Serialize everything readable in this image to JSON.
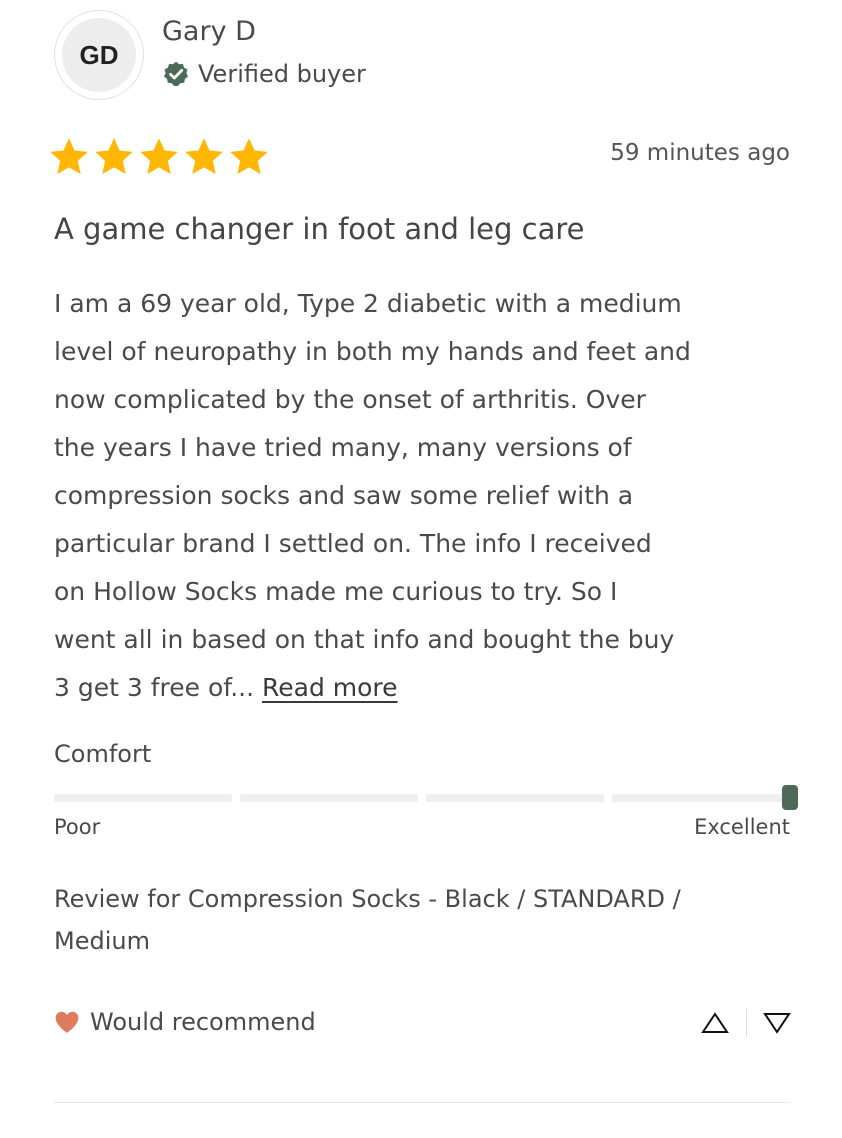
{
  "author": {
    "initials": "GD",
    "name": "Gary D",
    "verified_label": "Verified buyer"
  },
  "rating": {
    "stars": 5,
    "max_stars": 5
  },
  "timestamp": "59 minutes ago",
  "review": {
    "title": "A game changer in foot and leg care",
    "body_lines": [
      "I am a 69 year old, Type 2 diabetic with a medium",
      "level of neuropathy in both my hands and feet and",
      "now complicated by the onset of arthritis. Over",
      "the years I have tried many, many versions of",
      "compression socks and saw some relief with a",
      "particular brand I settled on. The info I received",
      "on Hollow Socks made me curious to try. So I",
      "went all in based on that info and bought the buy",
      "3 get 3 free of..."
    ],
    "read_more_label": "Read more"
  },
  "comfort": {
    "label": "Comfort",
    "min_label": "Poor",
    "max_label": "Excellent",
    "segments": 4,
    "value_fraction": 1.0
  },
  "product": {
    "lines": [
      "Review for Compression Socks - Black / STANDARD /",
      "Medium"
    ]
  },
  "recommend": {
    "label": "Would recommend"
  },
  "colors": {
    "star": "#FFB703",
    "verified_badge": "#4D6A59",
    "scale_marker": "#4D6A59",
    "heart": "#E07A5F",
    "text": "#4A4A4A"
  },
  "icons": {
    "verified": "verified-badge-icon",
    "star": "star-icon",
    "heart": "heart-icon",
    "upvote": "triangle-up-icon",
    "downvote": "triangle-down-icon"
  }
}
